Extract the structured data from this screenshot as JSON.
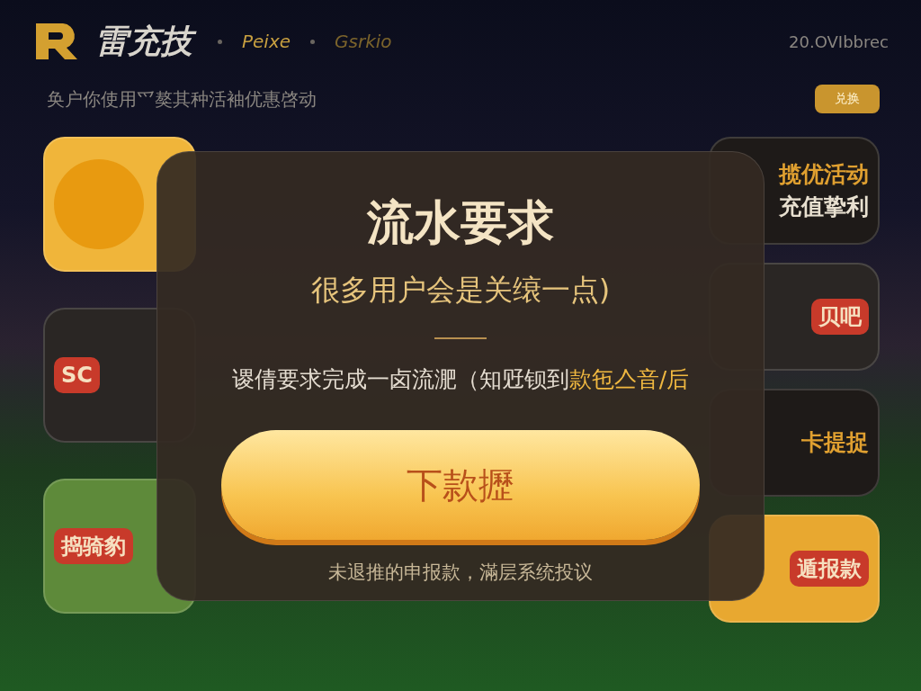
{
  "header": {
    "brand": "雷充技",
    "nav": [
      {
        "label": "Peixe",
        "selected": true
      },
      {
        "label": "Gsrkio",
        "selected": false
      }
    ],
    "right_text": "20.OVIbbrec"
  },
  "notice": {
    "text": "奂户你使用爫獒其种活袖优惠啓动",
    "button": "兑换"
  },
  "left_tiles": [
    {
      "kind": "emblem",
      "color": "#f0b53a"
    },
    {
      "kind": "badge",
      "color": "#2a2624",
      "label": "SC"
    },
    {
      "kind": "badge",
      "color": "#5e8a3a",
      "label": "捣骑豹"
    }
  ],
  "right_tiles": [
    {
      "kind": "text",
      "color": "#1e1a18",
      "label": "揽优活动",
      "label_2": "充值挚利"
    },
    {
      "kind": "badge",
      "color": "#2a2624",
      "label": "贝吧"
    },
    {
      "kind": "text",
      "color": "#1e1a18",
      "label": "卡提捉"
    },
    {
      "kind": "badge",
      "color": "#e8a830",
      "label": "遁报款"
    }
  ],
  "modal": {
    "title": "流水要求",
    "subtitle": "很多用户会是关缞一点)",
    "body": {
      "text": "谡倩要求完成一卤流淝（知觃钡到",
      "highlight": "款㐌亼音/后"
    },
    "button": "下款攊",
    "footnote": "未退推的申报款，滿层系统投议"
  }
}
